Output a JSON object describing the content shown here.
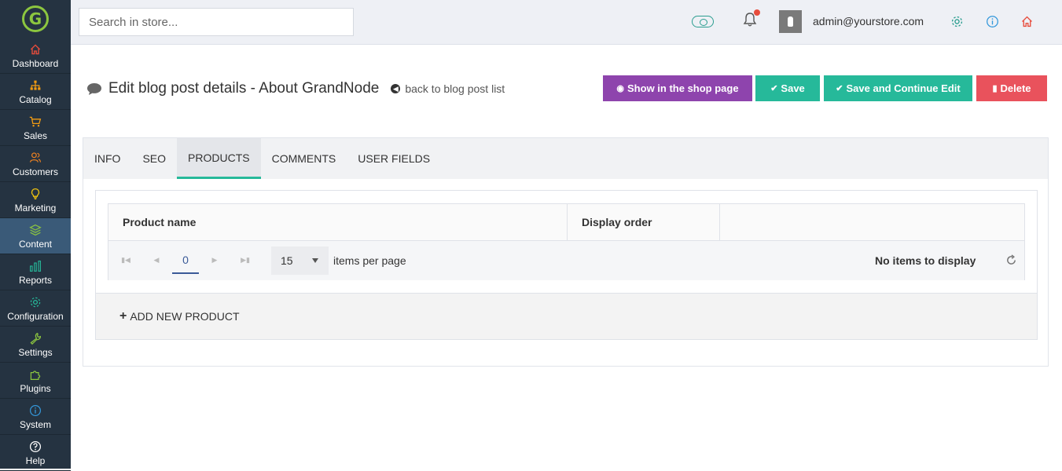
{
  "app": {
    "logo_letter": "G"
  },
  "sidebar": {
    "items": [
      {
        "label": "Dashboard",
        "icon": "home-icon",
        "color": "#e74c3c"
      },
      {
        "label": "Catalog",
        "icon": "sitemap-icon",
        "color": "#f39c12"
      },
      {
        "label": "Sales",
        "icon": "cart-icon",
        "color": "#f39c12"
      },
      {
        "label": "Customers",
        "icon": "users-icon",
        "color": "#e67e22"
      },
      {
        "label": "Marketing",
        "icon": "lightbulb-icon",
        "color": "#f1c40f"
      },
      {
        "label": "Content",
        "icon": "layers-icon",
        "color": "#8cc63f",
        "active": true
      },
      {
        "label": "Reports",
        "icon": "bar-chart-icon",
        "color": "#26b99a"
      },
      {
        "label": "Configuration",
        "icon": "gear-icon",
        "color": "#26b99a"
      },
      {
        "label": "Settings",
        "icon": "wrench-icon",
        "color": "#8cc63f"
      },
      {
        "label": "Plugins",
        "icon": "puzzle-icon",
        "color": "#8cc63f"
      },
      {
        "label": "System",
        "icon": "info-icon",
        "color": "#3498db"
      },
      {
        "label": "Help",
        "icon": "question-icon",
        "color": "#ffffff"
      }
    ]
  },
  "topbar": {
    "search_placeholder": "Search in store...",
    "user_email": "admin@yourstore.com"
  },
  "header": {
    "title": "Edit blog post details - About GrandNode",
    "back_link": "back to blog post list"
  },
  "toolbar": {
    "show_label": "Show in the shop page",
    "save_label": "Save",
    "save_continue_label": "Save and Continue Edit",
    "delete_label": "Delete"
  },
  "tabs": [
    {
      "label": "INFO"
    },
    {
      "label": "SEO"
    },
    {
      "label": "PRODUCTS",
      "active": true
    },
    {
      "label": "COMMENTS"
    },
    {
      "label": "USER FIELDS"
    }
  ],
  "grid": {
    "columns": [
      "Product name",
      "Display order",
      ""
    ],
    "pager": {
      "current_page": "0",
      "page_size": "15",
      "items_per_page_label": "items per page",
      "info": "No items to display"
    },
    "add_label": "ADD NEW PRODUCT"
  },
  "colors": {
    "sidebar_bg": "#253341",
    "sidebar_active": "#3a5a78",
    "purple": "#8e44ad",
    "green": "#26b99a",
    "red": "#e9525c"
  }
}
